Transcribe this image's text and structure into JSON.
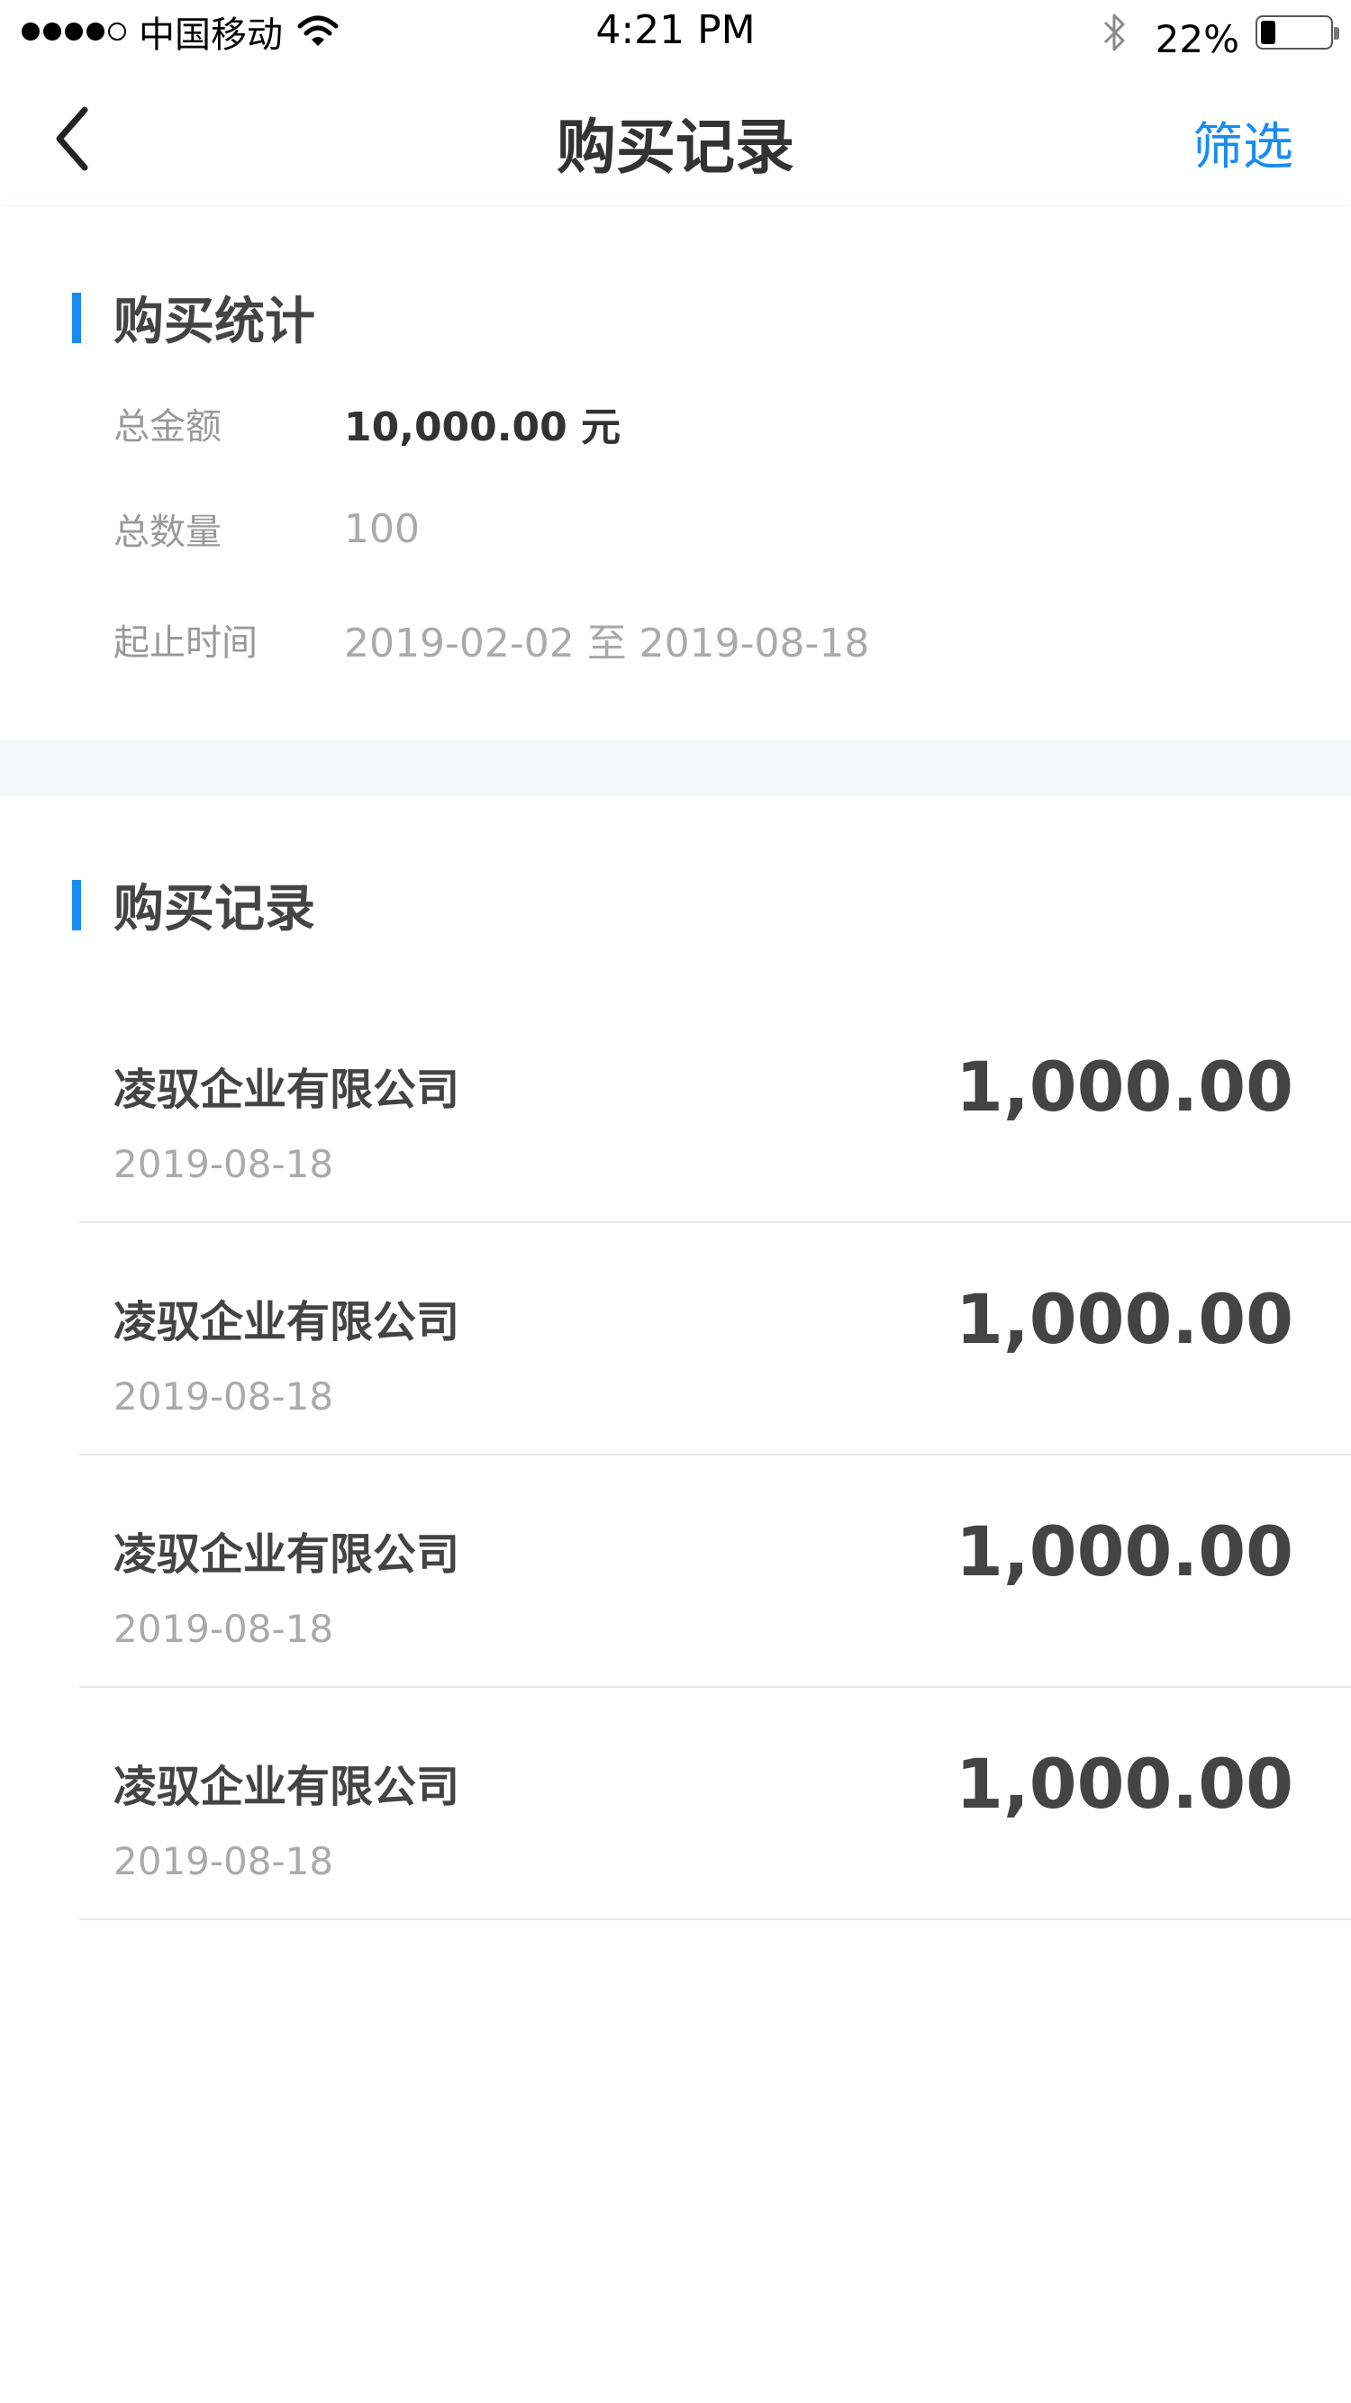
{
  "status_bar": {
    "carrier": "中国移动",
    "time": "4:21 PM",
    "battery_percent": "22%",
    "battery_level": 0.22,
    "signal_bars_filled": 4,
    "signal_bars_total": 5
  },
  "nav": {
    "title": "购买记录",
    "filter_label": "筛选",
    "back_icon": "chevron-left-icon"
  },
  "summary": {
    "title": "购买统计",
    "rows": [
      {
        "label": "总金额",
        "value": "10,000.00 元"
      },
      {
        "label": "总数量",
        "value": "100"
      },
      {
        "label": "起止时间",
        "value": "2019-02-02 至 2019-08-18"
      }
    ]
  },
  "records": {
    "title": "购买记录",
    "items": [
      {
        "company": "凌驭企业有限公司",
        "date": "2019-08-18",
        "amount": "1,000.00"
      },
      {
        "company": "凌驭企业有限公司",
        "date": "2019-08-18",
        "amount": "1,000.00"
      },
      {
        "company": "凌驭企业有限公司",
        "date": "2019-08-18",
        "amount": "1,000.00"
      },
      {
        "company": "凌驭企业有限公司",
        "date": "2019-08-18",
        "amount": "1,000.00"
      }
    ]
  },
  "colors": {
    "accent": "#1a8cf0",
    "text_primary": "#333333",
    "text_secondary": "#aaaaaa",
    "band_background": "#f7f8fa"
  }
}
